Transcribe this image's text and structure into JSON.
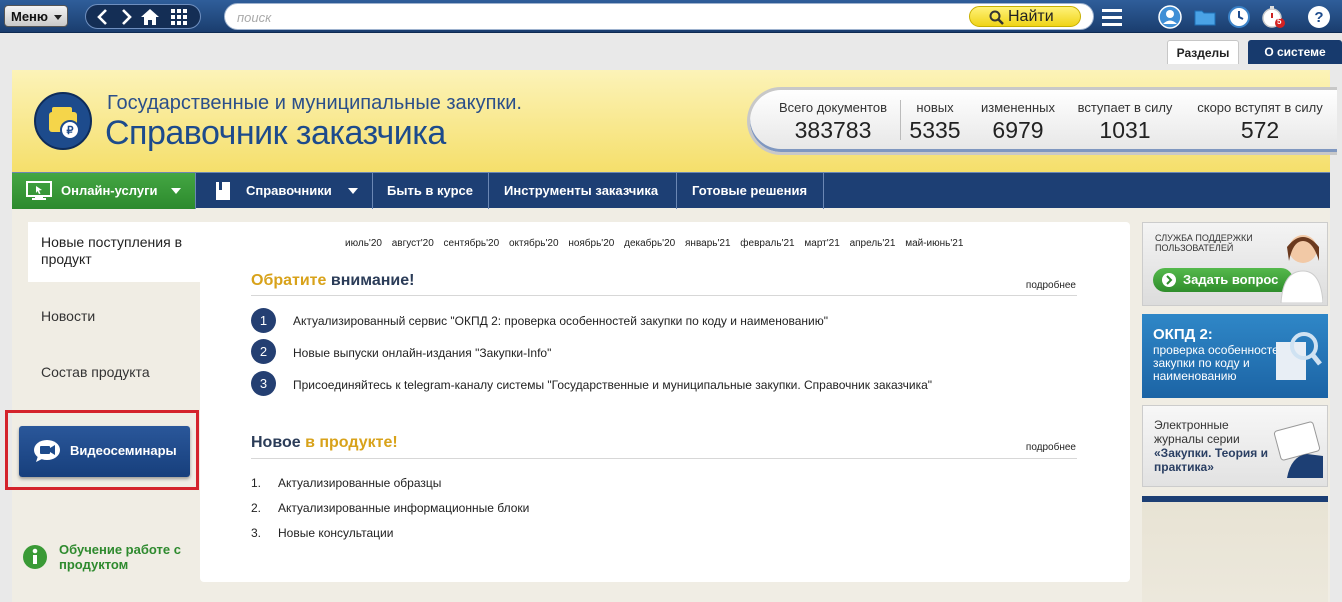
{
  "topbar": {
    "menu_label": "Меню",
    "search_placeholder": "поиск",
    "find_label": "Найти",
    "timer_badge": "5"
  },
  "tabs": {
    "razdely": "Разделы",
    "o_sisteme": "О системе"
  },
  "header": {
    "subtitle": "Государственные и муниципальные закупки.",
    "title": "Справочник заказчика"
  },
  "stats": [
    {
      "label": "Всего документов",
      "value": "383783"
    },
    {
      "label": "новых",
      "value": "5335"
    },
    {
      "label": "измененных",
      "value": "6979"
    },
    {
      "label": "вступает в силу",
      "value": "1031"
    },
    {
      "label": "скоро вступят в силу",
      "value": "572"
    }
  ],
  "nav": {
    "online": "Онлайн-услуги",
    "spravochniki": "Справочники",
    "byt_v_kurse": "Быть в курсе",
    "instrumenty": "Инструменты заказчика",
    "gotovye": "Готовые решения"
  },
  "sidebar": {
    "active": "Новые поступления в продукт",
    "novosti": "Новости",
    "sostav": "Состав продукта",
    "videoseminary": "Видеосеминары",
    "learn": "Обучение работе с продуктом"
  },
  "months": [
    "июль'20",
    "август'20",
    "сентябрь'20",
    "октябрь'20",
    "ноябрь'20",
    "декабрь'20",
    "январь'21",
    "февраль'21",
    "март'21",
    "апрель'21",
    "май-июнь'21"
  ],
  "attention": {
    "title_accent": "Обратите",
    "title_rest": "внимание!",
    "more": "подробнее",
    "items": [
      {
        "n": "1",
        "text": "Актуализированный сервис \"ОКПД 2: проверка особенностей закупки по коду и наименованию\""
      },
      {
        "n": "2",
        "text": "Новые выпуски онлайн-издания \"Закупки-Info\""
      },
      {
        "n": "3",
        "text": "Присоединяйтесь к telegram-каналу системы \"Государственные и муниципальные закупки. Справочник заказчика\""
      }
    ]
  },
  "new_in_product": {
    "title_start": "Новое",
    "title_accent": "в продукте!",
    "more": "подробнее",
    "items": [
      {
        "n": "1.",
        "text": "Актуализированные образцы"
      },
      {
        "n": "2.",
        "text": "Актуализированные информационные блоки"
      },
      {
        "n": "3.",
        "text": "Новые консультации"
      }
    ]
  },
  "banners": {
    "support_small": "СЛУЖБА ПОДДЕРЖКИ ПОЛЬЗОВАТЕЛЕЙ",
    "ask": "Задать вопрос",
    "okpd_title": "ОКПД 2:",
    "okpd_desc": "проверка особенностей закупки по коду и наименованию",
    "journal_desc": "Электронные журналы серии",
    "journal_bold": "«Закупки. Теория и практика»"
  }
}
